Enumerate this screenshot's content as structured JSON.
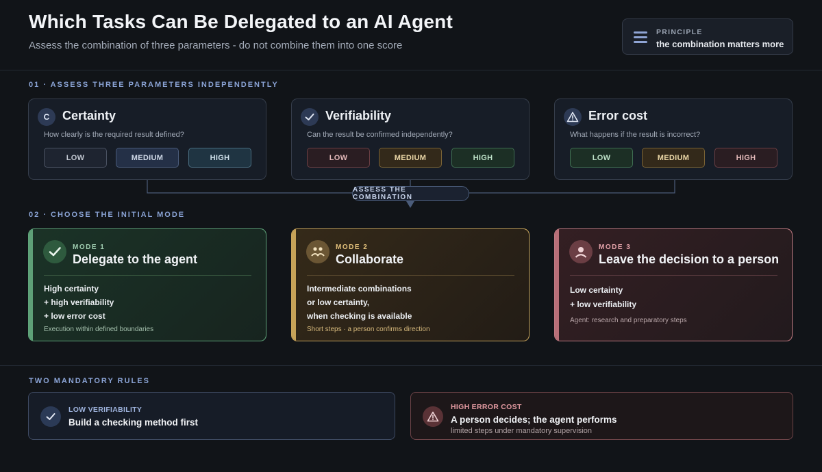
{
  "header": {
    "title": "Which Tasks Can Be Delegated to an AI Agent",
    "subtitle": "Assess the combination of three parameters - do not combine them into one score",
    "principle": {
      "kicker": "PRINCIPLE",
      "text": "the combination matters more",
      "icon": "menu-icon"
    }
  },
  "section1": {
    "label": "01 · ASSESS THREE PARAMETERS INDEPENDENTLY",
    "params": [
      {
        "icon_letter": "C",
        "icon": "certainty-icon",
        "title": "Certainty",
        "question": "How clearly is the required result defined?",
        "levels": [
          "LOW",
          "MEDIUM",
          "HIGH"
        ]
      },
      {
        "icon": "check-icon",
        "title": "Verifiability",
        "question": "Can the result be confirmed independently?",
        "levels": [
          "LOW",
          "MEDIUM",
          "HIGH"
        ]
      },
      {
        "icon": "warning-icon",
        "title": "Error cost",
        "question": "What happens if the result is incorrect?",
        "levels": [
          "LOW",
          "MEDIUM",
          "HIGH"
        ]
      }
    ],
    "connector_label": "ASSESS THE COMBINATION"
  },
  "section2": {
    "label": "02 · CHOOSE THE INITIAL MODE",
    "modes": [
      {
        "kicker": "MODE 1",
        "title": "Delegate to the agent",
        "icon": "check-icon",
        "lines": [
          "High certainty",
          "+ high verifiability",
          "+ low error cost"
        ],
        "footnote": "Execution within defined boundaries"
      },
      {
        "kicker": "MODE 2",
        "title": "Collaborate",
        "icon": "people-icon",
        "lines": [
          "Intermediate combinations",
          "or low certainty,",
          "when checking is available"
        ],
        "footnote": "Short steps · a person confirms direction"
      },
      {
        "kicker": "MODE 3",
        "title": "Leave the decision to a person",
        "icon": "person-icon",
        "lines": [
          "Low certainty",
          "+ low verifiability"
        ],
        "footnote": "Agent: research and preparatory steps"
      }
    ]
  },
  "rules": {
    "label": "TWO MANDATORY RULES",
    "items": [
      {
        "kicker": "LOW VERIFIABILITY",
        "title": "Build a checking method first",
        "icon": "check-icon"
      },
      {
        "kicker": "HIGH ERROR COST",
        "title": "A person decides; the agent performs",
        "subtitle": "limited steps under mandatory supervision",
        "icon": "warning-icon"
      }
    ]
  },
  "colors": {
    "background": "#111418",
    "accent": "#8ba4d6",
    "green": "#5ea077",
    "amber": "#c7a358",
    "rose": "#b86f78"
  }
}
